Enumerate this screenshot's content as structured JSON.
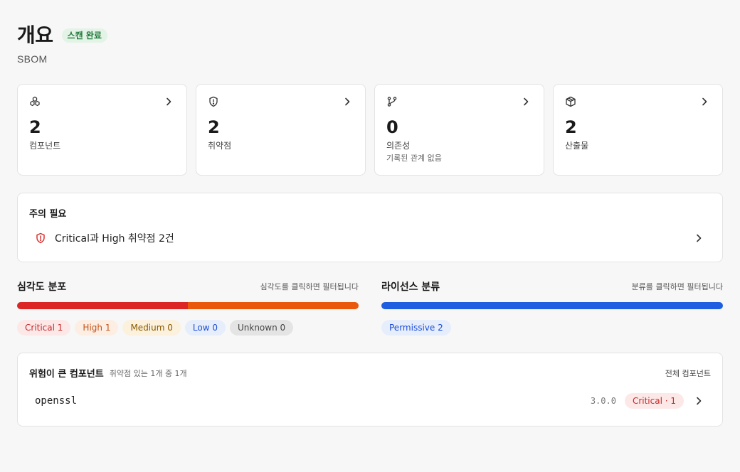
{
  "header": {
    "title": "개요",
    "status_badge": "스캔 완료",
    "subtitle": "SBOM"
  },
  "stats": [
    {
      "icon": "components-icon",
      "value": "2",
      "label": "컴포넌트",
      "note": ""
    },
    {
      "icon": "shield-icon",
      "value": "2",
      "label": "취약점",
      "note": ""
    },
    {
      "icon": "git-branch-icon",
      "value": "0",
      "label": "의존성",
      "note": "기록된 관계 없음"
    },
    {
      "icon": "package-icon",
      "value": "2",
      "label": "산출물",
      "note": ""
    }
  ],
  "attention": {
    "title": "주의 필요",
    "item_text": "Critical과 High 취약점 2건"
  },
  "severity": {
    "title": "심각도 분포",
    "hint": "심각도를 클릭하면 필터됩니다",
    "chips": [
      {
        "label": "Critical 1",
        "count": 1,
        "color": "#dc2626"
      },
      {
        "label": "High 1",
        "count": 1,
        "color": "#ea580c"
      },
      {
        "label": "Medium 0",
        "count": 0,
        "color": "#d97706"
      },
      {
        "label": "Low 0",
        "count": 0,
        "color": "#2563eb"
      },
      {
        "label": "Unknown 0",
        "count": 0,
        "color": "#9ca3af"
      }
    ]
  },
  "license": {
    "title": "라이선스 분류",
    "hint": "분류를 클릭하면 필터됩니다",
    "chips": [
      {
        "label": "Permissive 2",
        "count": 2,
        "color": "#1d5fe0"
      }
    ]
  },
  "risky": {
    "title": "위험이 큰 컴포넌트",
    "subtitle": "취약점 있는 1개 중 1개",
    "link": "전체 컴포넌트",
    "rows": [
      {
        "name": "openssl",
        "version": "3.0.0",
        "badge": "Critical · 1"
      }
    ]
  },
  "colors": {
    "status_badge_bg": "#e3f3e6",
    "critical": "#dc2626",
    "high": "#ea580c",
    "permissive": "#1d5fe0"
  }
}
